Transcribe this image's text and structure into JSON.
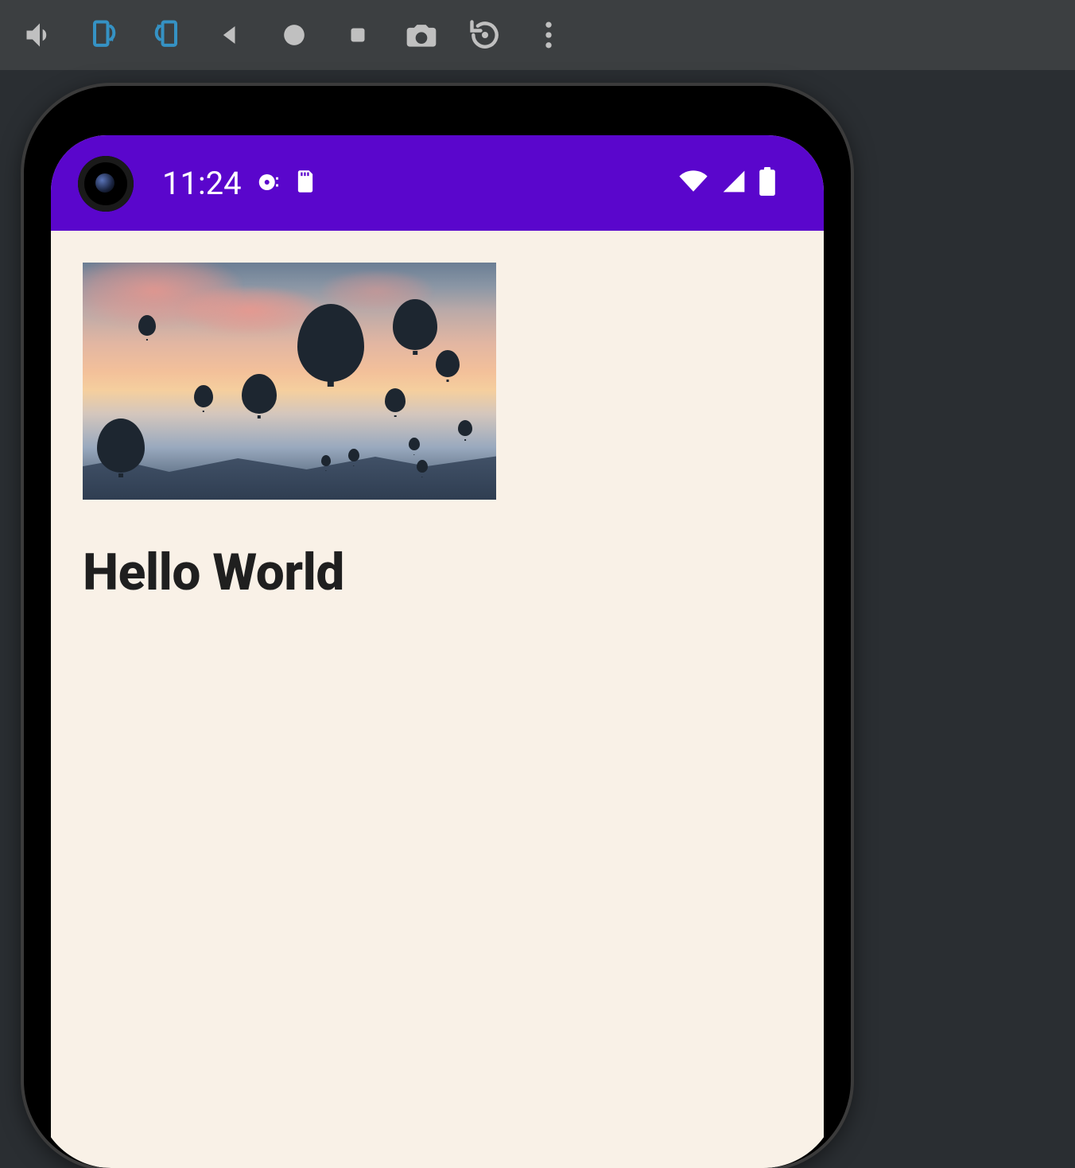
{
  "emulator": {
    "icons": {
      "volume": "volume-icon",
      "rotate_left": "rotate-left-icon",
      "rotate_right": "rotate-right-icon",
      "back": "back-icon",
      "record": "record-icon",
      "stop": "stop-icon",
      "screenshot": "camera-icon",
      "snapshot": "snapshot-reload-icon",
      "more": "more-vert-icon"
    }
  },
  "status": {
    "time": "11:24",
    "left_icons": {
      "disc": "disc-icon",
      "sd": "sd-card-icon"
    },
    "right_icons": {
      "wifi": "wifi-icon",
      "signal": "signal-icon",
      "battery": "battery-icon"
    }
  },
  "app": {
    "image_alt": "hot air balloons at sunset",
    "headline": "Hello World"
  },
  "colors": {
    "status_bar": "#5a06cc",
    "app_bg": "#f9f1e7",
    "emu_toolbar": "#3c3f41",
    "stage_bg": "#2a2e32"
  }
}
